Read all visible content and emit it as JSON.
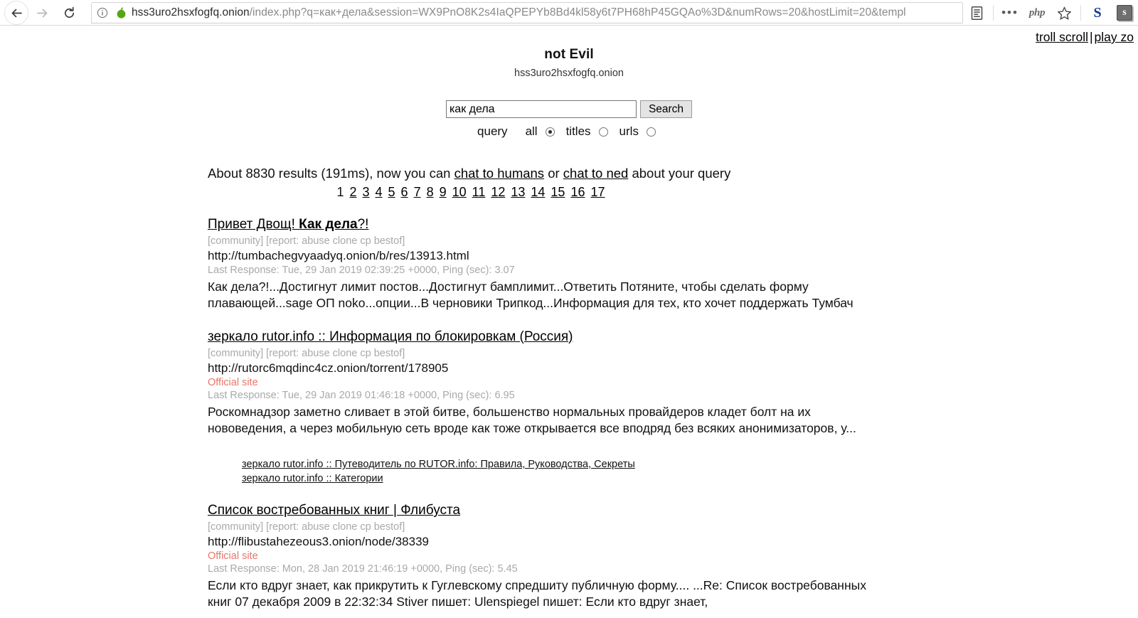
{
  "browser": {
    "back_icon": "back-arrow-icon",
    "forward_icon": "forward-arrow-icon",
    "reload_icon": "reload-icon",
    "info_icon": "info-circle-icon",
    "onion_icon": "onion-icon",
    "url_host": "hss3uro2hsxfogfq.onion",
    "url_path": "/index.php?q=как+дела&session=WX9PnO8K2s4IaQPEPYb8Bd4kl58y6t7PH68hP45GQAo%3D&numRows=20&hostLimit=20&templ",
    "reader_icon": "reader-view-icon",
    "menu_icon": "more-options-icon",
    "php_icon": "php",
    "bookmark_icon": "star-icon",
    "ext_s_icon": "S",
    "ext_s2_icon": "s"
  },
  "corner": {
    "troll_scroll": "troll scroll",
    "separator": "|",
    "play_zone": "play zo"
  },
  "site": {
    "title": "not Evil",
    "domain": "hss3uro2hsxfogfq.onion"
  },
  "search": {
    "query_value": "как дела",
    "placeholder": "",
    "button_label": "Search",
    "scope_label": "query",
    "options": [
      {
        "label": "all",
        "selected": true
      },
      {
        "label": "titles",
        "selected": false
      },
      {
        "label": "urls",
        "selected": false
      }
    ]
  },
  "summary": {
    "prefix": "About 8830 results (191ms), now you can ",
    "link1": "chat to humans",
    "middle": " or ",
    "link2": "chat to ned",
    "suffix": " about your query",
    "result_count": "8830",
    "time_ms": "191ms"
  },
  "pagination": {
    "current": "1",
    "pages": [
      "2",
      "3",
      "4",
      "5",
      "6",
      "7",
      "8",
      "9",
      "10",
      "11",
      "12",
      "13",
      "14",
      "15",
      "16",
      "17"
    ]
  },
  "results": [
    {
      "title_plain_before": "Привет Двощ! ",
      "title_bold": "Как дела",
      "title_plain_after": "?!",
      "tags": "[community] [report: abuse clone cp bestof]",
      "url": "http://tumbachegvyaadyq.onion/b/res/13913.html",
      "official": null,
      "meta": "Last Response: Tue, 29 Jan 2019 02:39:25 +0000, Ping (sec): 3.07",
      "snippet": "Как дела?!...Достигнут лимит постов...Достигнут бамплимит...Ответить Потяните, чтобы сделать форму плавающей...sage ОП noko...опции...В черновики Трипкод...Информация для тех, кто хочет поддержать Тумбач",
      "sublinks": []
    },
    {
      "title_plain_before": "зеркало rutor.info :: Информация по блокировкам (Россия)",
      "title_bold": "",
      "title_plain_after": "",
      "tags": "[community] [report: abuse clone cp bestof]",
      "url": "http://rutorc6mqdinc4cz.onion/torrent/178905",
      "official": "Official site",
      "meta": "Last Response: Tue, 29 Jan 2019 01:46:18 +0000, Ping (sec): 6.95",
      "snippet": "Роскомнадзор заметно сливает в этой битве, большенство нормальных провайдеров кладет болт на их нововедения, а через мобильную сеть вроде как тоже открывается все вподряд без всяких анонимизаторов, у...",
      "sublinks": [
        "зеркало rutor.info :: Путеводитель по RUTOR.info: Правила, Руководства, Секреты",
        "зеркало rutor.info :: Категории"
      ]
    },
    {
      "title_plain_before": "Список востребованных книг | Флибуста",
      "title_bold": "",
      "title_plain_after": "",
      "tags": "[community] [report: abuse clone cp bestof]",
      "url": "http://flibustahezeous3.onion/node/38339",
      "official": "Official site",
      "meta": "Last Response: Mon, 28 Jan 2019 21:46:19 +0000, Ping (sec): 5.45",
      "snippet": "Если кто вдруг знает, как прикрутить к Гуглевскому спредшиту публичную форму.... ...Re: Список востребованных книг  07 декабря 2009  в 22:32:34 Stiver пишет:   Ulenspiegel пишет:   Если кто вдруг знает,",
      "sublinks": []
    }
  ],
  "colors": {
    "official_site": "#e8766b",
    "muted_text": "#a9a9a9",
    "link": "#000000",
    "onion_green": "#5faa1e"
  }
}
